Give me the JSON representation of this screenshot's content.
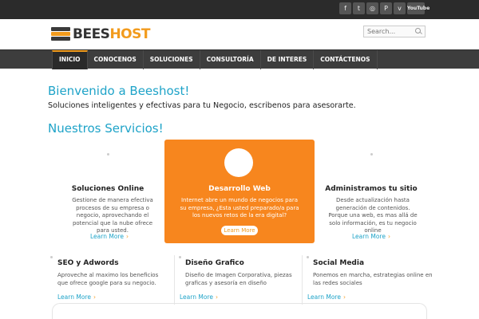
{
  "topbar": {
    "social": [
      {
        "icon": "facebook-icon",
        "glyph": "f"
      },
      {
        "icon": "twitter-icon",
        "glyph": "t"
      },
      {
        "icon": "dribbble-icon",
        "glyph": "◎"
      },
      {
        "icon": "pinterest-icon",
        "glyph": "P"
      },
      {
        "icon": "vimeo-icon",
        "glyph": "v"
      },
      {
        "icon": "youtube-icon",
        "glyph": "YouTube"
      }
    ]
  },
  "header": {
    "logo_bees": "BEES",
    "logo_host": "HOST",
    "search_placeholder": "Search..."
  },
  "nav": {
    "items": [
      "INICIO",
      "CONOCENOS",
      "SOLUCIONES",
      "CONSULTORÍA",
      "DE INTERES",
      "CONTÁCTENOS"
    ]
  },
  "main": {
    "welcome": "Bienvenido a Beeshost!",
    "tagline": "Soluciones inteligentes y efectivas para tu Negocio, escribenos para asesorarte.",
    "services_heading": "Nuestros Servicios!"
  },
  "services_top": [
    {
      "title": "Soluciones Online",
      "text": "Gestione de manera efectiva procesos de su empresa o negocio, aprovechando el potencial que la nube ofrece para usted.",
      "link": "Learn More"
    },
    {
      "title": "Desarrollo Web",
      "text": "Internet abre un mundo de negocios para su empresa, ¿Esta usted preparado/a para los nuevos retos de la era digital?",
      "link": "Learn More"
    },
    {
      "title": "Administramos tu sitio",
      "text": "Desde actualización hasta generación de contenidos. Porque una web, es mas allá de solo información, es tu negocio online",
      "link": "Learn More"
    }
  ],
  "services_bottom": [
    {
      "title": "SEO y Adwords",
      "text": "Aproveche al maximo los beneficios que ofrece google para su negocio.",
      "link": "Learn More"
    },
    {
      "title": "Diseño Grafico",
      "text": "Diseño de Imagen Corporativa, piezas graficas y asesoría en diseño",
      "link": "Learn More"
    },
    {
      "title": "Social Media",
      "text": "Ponemos en marcha, estrategias online en las redes sociales",
      "link": "Learn More"
    }
  ],
  "colors": {
    "accent_blue": "#1ea3c8",
    "accent_orange": "#f7861e",
    "nav_bg": "#3d3d3d",
    "topbar_bg": "#2b2b2b"
  }
}
